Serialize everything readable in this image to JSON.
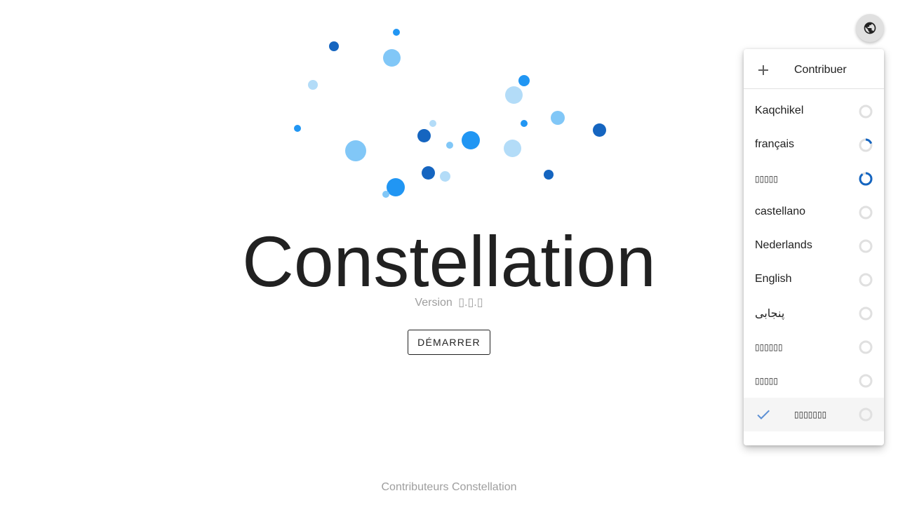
{
  "hero": {
    "title": "Constellation",
    "version_label": "Version",
    "version_number": "▯.▯.▯",
    "start_button": "Démarrer"
  },
  "footer": {
    "text": "Contributeurs Constellation"
  },
  "language_button": {
    "icon": "globe-icon"
  },
  "menu": {
    "contribute_label": "Contribuer",
    "contribute_icon": "plus-icon",
    "items": [
      {
        "label": "Kaqchikel",
        "progress": 0
      },
      {
        "label": "français",
        "progress": 0.2
      },
      {
        "label": "▯▯▯▯▯",
        "progress": 0.9
      },
      {
        "label": "castellano",
        "progress": 0
      },
      {
        "label": "Nederlands",
        "progress": 0
      },
      {
        "label": "English",
        "progress": 0
      },
      {
        "label": "پنجابی",
        "progress": 0
      },
      {
        "label": "▯▯▯▯▯▯",
        "progress": 0
      },
      {
        "label": "▯▯▯▯▯",
        "progress": 0
      },
      {
        "label": "▯▯▯▯▯▯▯",
        "progress": 0,
        "selected": true
      }
    ]
  },
  "colors": {
    "dark_blue": "#1565c0",
    "mid_blue": "#2196f3",
    "light_blue": "#81c7f7",
    "pale_blue": "#b3dcf8",
    "progress_track": "#e0e0e0",
    "check": "#5b8fd4"
  }
}
